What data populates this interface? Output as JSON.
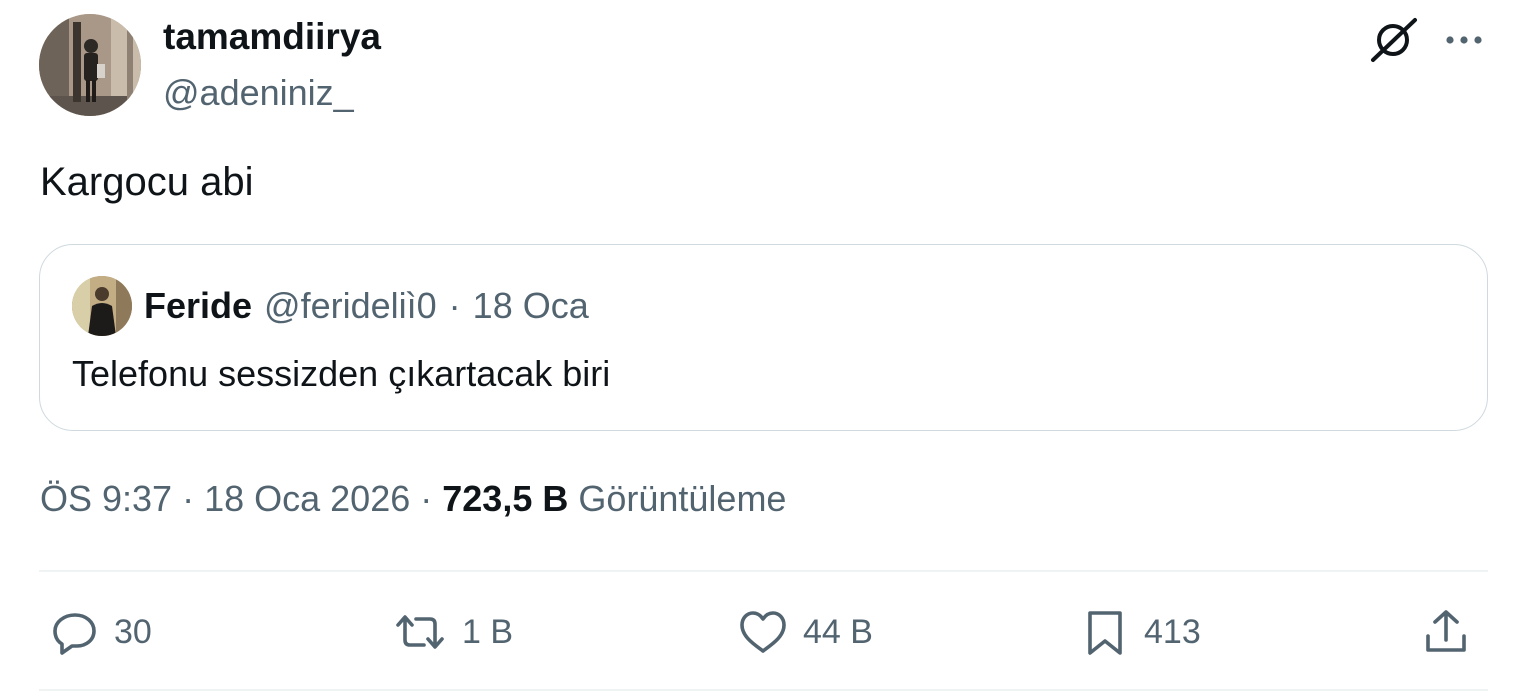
{
  "author": {
    "display_name": "tamamdiirya",
    "handle": "@adeniniz_"
  },
  "tweet": {
    "text": "Kargocu abi"
  },
  "quoted": {
    "display_name": "Feride",
    "handle": "@ferideliì0",
    "separator": "·",
    "date": "18 Oca",
    "text": "Telefonu sessizden çıkartacak biri"
  },
  "meta": {
    "time": "ÖS 9:37",
    "separator": "·",
    "date": "18 Oca 2026",
    "separator2": "·",
    "views_count": "723,5 B",
    "views_label": "Görüntüleme"
  },
  "actions": {
    "replies": "30",
    "reposts": "1 B",
    "likes": "44 B",
    "bookmarks": "413"
  },
  "icons": {
    "grok": "grok-icon",
    "more": "more-icon",
    "reply": "reply-icon",
    "repost": "repost-icon",
    "like": "heart-icon",
    "bookmark": "bookmark-icon",
    "share": "share-icon"
  },
  "colors": {
    "text_primary": "#0f1419",
    "text_secondary": "#536471",
    "border": "#cfd9de",
    "divider": "#eff3f4",
    "icon": "#536471"
  }
}
